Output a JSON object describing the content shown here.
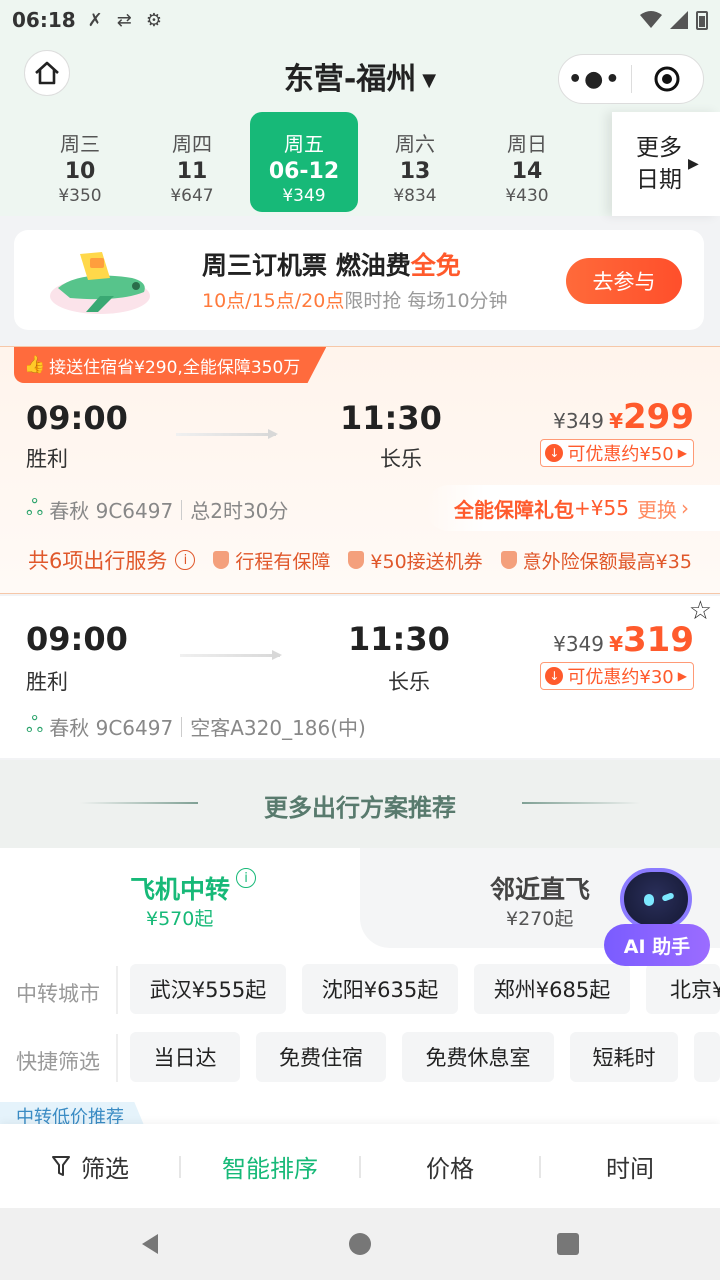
{
  "status": {
    "time": "06:18"
  },
  "header": {
    "title": "东营-福州"
  },
  "dates": [
    {
      "weekday": "周三",
      "date": "10",
      "price": "¥350",
      "active": false
    },
    {
      "weekday": "周四",
      "date": "11",
      "price": "¥647",
      "active": false
    },
    {
      "weekday": "周五",
      "date": "06-12",
      "price": "¥349",
      "active": true
    },
    {
      "weekday": "周六",
      "date": "13",
      "price": "¥834",
      "active": false
    },
    {
      "weekday": "周日",
      "date": "14",
      "price": "¥430",
      "active": false
    }
  ],
  "more_dates": {
    "line1": "更多",
    "line2": "日期"
  },
  "promo": {
    "title_a": "周三订机票 燃油费",
    "title_b": "全免",
    "sub_a": "10点/15点/20点",
    "sub_b": "限时抢 每场10分钟",
    "button": "去参与"
  },
  "flight1": {
    "tag": "接送住宿省¥290,全能保障350万",
    "dep_time": "09:00",
    "dep_city": "胜利",
    "arr_time": "11:30",
    "arr_city": "长乐",
    "old_price": "¥349",
    "cur_symbol": "¥",
    "price": "299",
    "discount": "可优惠约¥50",
    "airline": "春秋 9C6497",
    "duration": "总2时30分",
    "package_a": "全能保障礼包",
    "package_b": "+¥55",
    "package_c": "更换",
    "services_main": "共6项出行服务",
    "services": [
      "行程有保障",
      "¥50接送机券",
      "意外险保额最高¥35"
    ]
  },
  "flight2": {
    "dep_time": "09:00",
    "dep_city": "胜利",
    "arr_time": "11:30",
    "arr_city": "长乐",
    "old_price": "¥349",
    "cur_symbol": "¥",
    "price": "319",
    "discount": "可优惠约¥30",
    "airline": "春秋 9C6497",
    "aircraft": "空客A320_186(中)"
  },
  "recommend": {
    "title": "更多出行方案推荐"
  },
  "transfer": {
    "tab_left": {
      "label": "飞机中转",
      "price": "¥570起"
    },
    "tab_right": {
      "label": "邻近直飞",
      "price": "¥270起"
    },
    "city_label": "中转城市",
    "cities": [
      "武汉¥555起",
      "沈阳¥635起",
      "郑州¥685起",
      "北京¥"
    ],
    "filter_label": "快捷筛选",
    "filters": [
      "当日达",
      "免费住宿",
      "免费休息室",
      "短耗时"
    ],
    "low_tag": "中转低价推荐"
  },
  "ai": {
    "label": "AI 助手"
  },
  "sort": {
    "filter": "筛选",
    "smart": "智能排序",
    "price": "价格",
    "time": "时间"
  },
  "colors": {
    "accent": "#17b978",
    "orange": "#ff5a2c"
  }
}
